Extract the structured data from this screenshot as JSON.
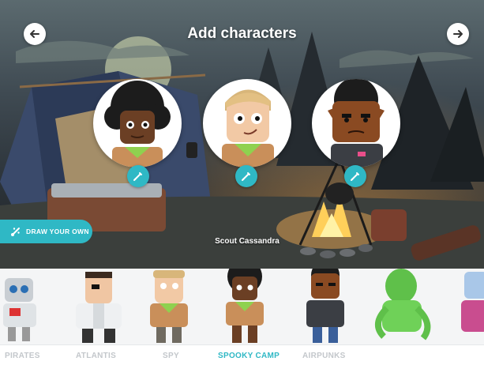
{
  "header": {
    "title": "Add characters"
  },
  "selected_character_name": "Scout Cassandra",
  "draw_button_label": "DRAW YOUR OWN",
  "tabs": [
    {
      "label": "PIRATES",
      "active": false
    },
    {
      "label": "ATLANTIS",
      "active": false
    },
    {
      "label": "SPY",
      "active": false
    },
    {
      "label": "SPOOKY CAMP",
      "active": true
    },
    {
      "label": "AIRPUNKS",
      "active": false
    }
  ],
  "colors": {
    "accent": "#2fb8c5",
    "tab_inactive": "#c3c7cb",
    "scout_shirt": "#c98f5a",
    "scarf": "#8fd14f"
  },
  "icons": {
    "back": "arrow-left-icon",
    "forward": "arrow-right-icon",
    "edit": "pencil-icon",
    "draw": "brush-icon"
  }
}
